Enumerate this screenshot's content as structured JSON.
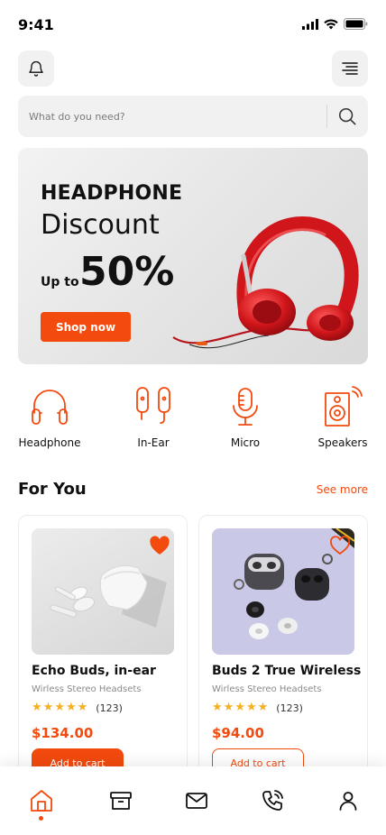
{
  "status": {
    "time": "9:41"
  },
  "search": {
    "placeholder": "What do you need?"
  },
  "banner": {
    "title": "HEADPHONE",
    "subtitle": "Discount",
    "prefix": "Up to",
    "percent": "50%",
    "cta": "Shop now"
  },
  "categories": [
    {
      "label": "Headphone",
      "icon": "headphone-icon"
    },
    {
      "label": "In-Ear",
      "icon": "in-ear-icon"
    },
    {
      "label": "Micro",
      "icon": "microphone-icon"
    },
    {
      "label": "Speakers",
      "icon": "speaker-icon"
    }
  ],
  "section": {
    "title": "For You",
    "see_more": "See more"
  },
  "products": [
    {
      "name": "Echo Buds, in-ear",
      "subtitle": "Wirless Stereo Headsets",
      "rating": 5,
      "reviews": "(123)",
      "price": "$134.00",
      "cta": "Add to cart",
      "favorite": true
    },
    {
      "name": "Buds 2 True Wireless",
      "subtitle": "Wirless Stereo Headsets",
      "rating": 5,
      "reviews": "(123)",
      "price": "$94.00",
      "cta": "Add to cart",
      "favorite": false
    }
  ],
  "tabs": [
    {
      "icon": "home-icon",
      "active": true
    },
    {
      "icon": "archive-box-icon",
      "active": false
    },
    {
      "icon": "mail-icon",
      "active": false
    },
    {
      "icon": "phone-call-icon",
      "active": false
    },
    {
      "icon": "user-icon",
      "active": false
    }
  ],
  "colors": {
    "accent": "#f34a0e",
    "star": "#f5b021",
    "surface": "#f1f1f1"
  }
}
